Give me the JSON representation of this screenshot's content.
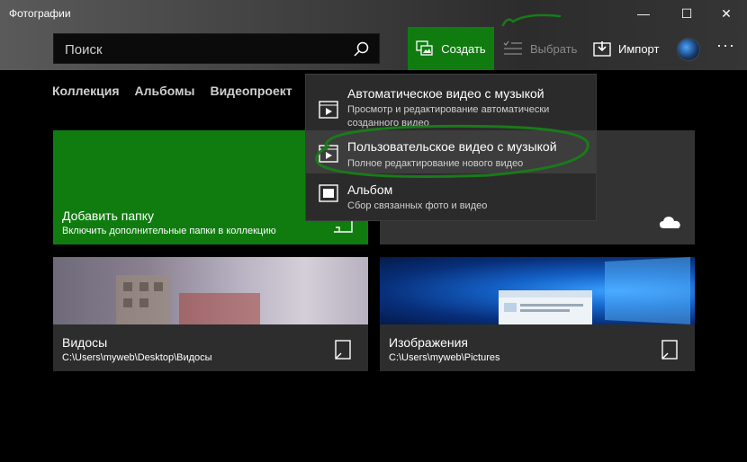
{
  "window": {
    "title": "Фотографии",
    "minimize": "—",
    "maximize": "☐",
    "close": "✕"
  },
  "search": {
    "placeholder": "Поиск"
  },
  "toolbar": {
    "create_label": "Создать",
    "select_label": "Выбрать",
    "import_label": "Импорт",
    "more": "···"
  },
  "tabs": [
    {
      "label": "Коллекция"
    },
    {
      "label": "Альбомы"
    },
    {
      "label": "Видеопроект"
    }
  ],
  "tiles": {
    "add_folder": {
      "title": "Добавить папку",
      "subtitle": "Включить дополнительные папки в коллекцию"
    },
    "videos": {
      "title": "Видосы",
      "path": "C:\\Users\\myweb\\Desktop\\Видосы"
    },
    "images": {
      "title": "Изображения",
      "path": "C:\\Users\\myweb\\Pictures"
    }
  },
  "create_menu": {
    "items": [
      {
        "title": "Автоматическое видео с музыкой",
        "subtitle": "Просмотр и редактирование автоматически созданного видео",
        "icon": "video-icon"
      },
      {
        "title": "Пользовательское видео с музыкой",
        "subtitle": "Полное редактирование нового видео",
        "icon": "video-icon"
      },
      {
        "title": "Альбом",
        "subtitle": "Сбор связанных фото и видео",
        "icon": "album-icon"
      }
    ]
  },
  "colors": {
    "accent": "#107c10",
    "menu_bg": "#2b2b2b",
    "annotation": "#1a7a1a"
  }
}
